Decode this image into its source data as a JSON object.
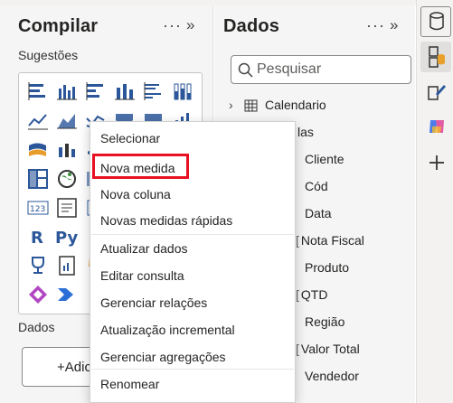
{
  "compilar": {
    "title": "Compilar",
    "suggestions_label": "Sugestões",
    "dados_label": "Dados",
    "add_button_label": "+Adic"
  },
  "dados": {
    "title": "Dados",
    "search_placeholder": "Pesquisar",
    "table_name": "Calendario",
    "partial_label": "las",
    "fields": [
      "Cliente",
      "Cód",
      "Data",
      "Nota Fiscal",
      "Produto",
      "QTD",
      "Região",
      "Valor Total",
      "Vendedor"
    ]
  },
  "context_menu": {
    "items": [
      "Selecionar",
      "Nova medida",
      "Nova coluna",
      "Novas medidas rápidas",
      "Atualizar dados",
      "Editar consulta",
      "Gerenciar relações",
      "Atualização incremental",
      "Gerenciar agregações",
      "Renomear"
    ],
    "highlighted": "Nova medida"
  },
  "colors": {
    "accent_blue": "#2b579a",
    "highlight_red": "#e81123",
    "pane_bg": "#f5f5f5"
  },
  "icons": {
    "viz_types": [
      "stacked-bar",
      "clustered-column",
      "stacked-bar-100",
      "stacked-column",
      "clustered-bar",
      "column-100",
      "line-chart",
      "area-chart",
      "stacked-area",
      "ribbon-chart",
      "waterfall",
      "combo-chart",
      "scatter",
      "pie",
      "donut",
      "treemap",
      "map",
      "filled-map",
      "table",
      "matrix",
      "card",
      "r-visual",
      "python-visual",
      "key-influencers",
      "kpi",
      "paginated-report",
      "power-apps",
      "power-automate"
    ],
    "rail": [
      "data-cylinder-icon",
      "model-view-icon",
      "format-brush-icon",
      "copilot-icon",
      "add-icon"
    ]
  }
}
